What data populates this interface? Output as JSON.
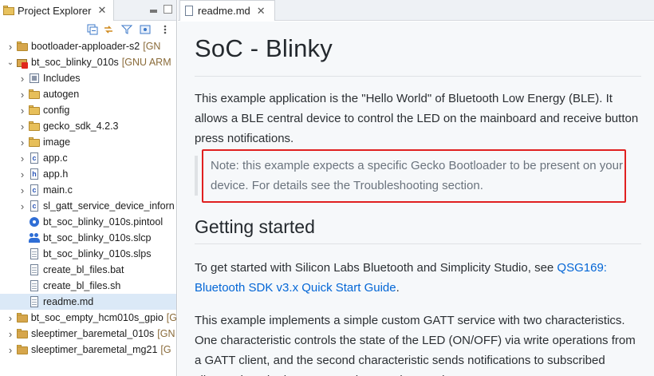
{
  "project_explorer": {
    "tab_title": "Project Explorer",
    "close_glyph": "✕",
    "tree": [
      {
        "label": "bootloader-apploader-s2",
        "suffix": "[GN",
        "icon": "project-icon",
        "expanded": false,
        "level": 0
      },
      {
        "label": "bt_soc_blinky_010s",
        "suffix": "[GNU ARM",
        "icon": "project-error-icon",
        "expanded": true,
        "level": 0
      },
      {
        "label": "Includes",
        "suffix": "",
        "icon": "includes-icon",
        "expanded": false,
        "level": 1
      },
      {
        "label": "autogen",
        "suffix": "",
        "icon": "folder-icon",
        "expanded": false,
        "level": 1
      },
      {
        "label": "config",
        "suffix": "",
        "icon": "folder-icon",
        "expanded": false,
        "level": 1
      },
      {
        "label": "gecko_sdk_4.2.3",
        "suffix": "",
        "icon": "folder-icon",
        "expanded": false,
        "level": 1
      },
      {
        "label": "image",
        "suffix": "",
        "icon": "folder-icon",
        "expanded": false,
        "level": 1
      },
      {
        "label": "app.c",
        "suffix": "",
        "icon": "c-file-icon",
        "expanded": false,
        "level": 1
      },
      {
        "label": "app.h",
        "suffix": "",
        "icon": "h-file-icon",
        "expanded": false,
        "level": 1
      },
      {
        "label": "main.c",
        "suffix": "",
        "icon": "c-file-icon",
        "expanded": false,
        "level": 1
      },
      {
        "label": "sl_gatt_service_device_inforn",
        "suffix": "",
        "icon": "c-file-icon",
        "expanded": false,
        "level": 1
      },
      {
        "label": "bt_soc_blinky_010s.pintool",
        "suffix": "",
        "icon": "gear-icon",
        "expanded": null,
        "level": 1
      },
      {
        "label": "bt_soc_blinky_010s.slcp",
        "suffix": "",
        "icon": "people-icon",
        "expanded": null,
        "level": 1
      },
      {
        "label": "bt_soc_blinky_010s.slps",
        "suffix": "",
        "icon": "file-icon",
        "expanded": null,
        "level": 1
      },
      {
        "label": "create_bl_files.bat",
        "suffix": "",
        "icon": "file-icon",
        "expanded": null,
        "level": 1
      },
      {
        "label": "create_bl_files.sh",
        "suffix": "",
        "icon": "file-icon",
        "expanded": null,
        "level": 1
      },
      {
        "label": "readme.md",
        "suffix": "",
        "icon": "file-icon",
        "expanded": null,
        "level": 1,
        "selected": true
      },
      {
        "label": "bt_soc_empty_hcm010s_gpio",
        "suffix": "[G",
        "icon": "project-icon",
        "expanded": false,
        "level": 0
      },
      {
        "label": "sleeptimer_baremetal_010s",
        "suffix": "[GN",
        "icon": "project-icon",
        "expanded": false,
        "level": 0
      },
      {
        "label": "sleeptimer_baremetal_mg21",
        "suffix": "[G",
        "icon": "project-icon",
        "expanded": false,
        "level": 0
      }
    ]
  },
  "editor": {
    "tab_title": "readme.md",
    "close_glyph": "✕",
    "title": "SoC - Blinky",
    "intro": "This example application is the \"Hello World\" of Bluetooth Low Energy (BLE). It allows a BLE central device to control the LED on the mainboard and receive button press notifications.",
    "note": "Note: this example expects a specific Gecko Bootloader to be present on your device. For details see the Troubleshooting section.",
    "h2": "Getting started",
    "getting_started_prefix": "To get started with Silicon Labs Bluetooth and Simplicity Studio, see ",
    "getting_started_link": "QSG169: Bluetooth SDK v3.x Quick Start Guide",
    "getting_started_suffix": ".",
    "para3": "This example implements a simple custom GATT service with two characteristics. One characteristic controls the state of the LED (ON/OFF) via write operations from a GATT client, and the second characteristic sends notifications to subscribed clients when the button state changes (pressed or"
  },
  "colors": {
    "link": "#0366d6",
    "highlight_box": "#e02020",
    "selection": "#dbe9f7"
  }
}
